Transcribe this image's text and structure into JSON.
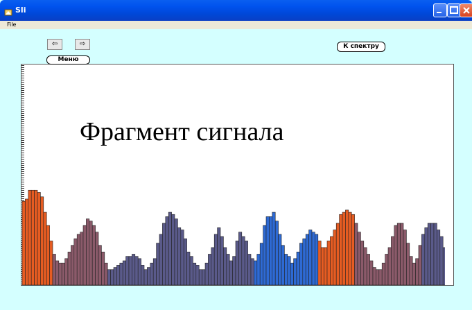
{
  "window": {
    "title": "Sli",
    "app_icon": "app-icon",
    "controls": [
      "minimize-icon",
      "maximize-icon",
      "close-icon"
    ]
  },
  "menu": {
    "file": "File"
  },
  "nav": {
    "prev_icon": "arrow-left-icon",
    "prev_glyph": "⇦",
    "next_icon": "arrow-right-icon",
    "next_glyph": "⇨"
  },
  "buttons": {
    "spectrum": "К спектру",
    "menu": "Меню"
  },
  "panel": {
    "title": "Фрагмент сигнала"
  },
  "colors": {
    "background": "#d4ffff",
    "bar_orange": "#e65c22",
    "bar_mauve": "#8b5a6a",
    "bar_slate": "#5a5a8a",
    "bar_blue": "#2e6ad4"
  },
  "chart_data": {
    "type": "bar",
    "values": [
      0.38,
      0.39,
      0.43,
      0.43,
      0.43,
      0.42,
      0.4,
      0.33,
      0.27,
      0.2,
      0.14,
      0.11,
      0.1,
      0.1,
      0.12,
      0.15,
      0.18,
      0.21,
      0.23,
      0.24,
      0.27,
      0.3,
      0.29,
      0.27,
      0.24,
      0.18,
      0.15,
      0.1,
      0.07,
      0.07,
      0.08,
      0.09,
      0.1,
      0.11,
      0.13,
      0.13,
      0.14,
      0.13,
      0.12,
      0.09,
      0.07,
      0.08,
      0.1,
      0.12,
      0.19,
      0.23,
      0.28,
      0.31,
      0.33,
      0.32,
      0.3,
      0.26,
      0.25,
      0.21,
      0.15,
      0.13,
      0.1,
      0.09,
      0.07,
      0.07,
      0.1,
      0.14,
      0.17,
      0.23,
      0.26,
      0.22,
      0.17,
      0.14,
      0.11,
      0.13,
      0.2,
      0.24,
      0.22,
      0.2,
      0.14,
      0.12,
      0.11,
      0.14,
      0.19,
      0.27,
      0.31,
      0.31,
      0.33,
      0.29,
      0.23,
      0.18,
      0.14,
      0.13,
      0.1,
      0.12,
      0.15,
      0.19,
      0.21,
      0.23,
      0.25,
      0.24,
      0.23,
      0.2,
      0.17,
      0.17,
      0.2,
      0.22,
      0.25,
      0.28,
      0.32,
      0.33,
      0.34,
      0.33,
      0.32,
      0.28,
      0.24,
      0.2,
      0.17,
      0.14,
      0.11,
      0.08,
      0.07,
      0.07,
      0.1,
      0.14,
      0.17,
      0.22,
      0.27,
      0.28,
      0.28,
      0.25,
      0.19,
      0.13,
      0.1,
      0.12,
      0.18,
      0.23,
      0.26,
      0.28,
      0.28,
      0.28,
      0.25,
      0.22,
      0.17,
      0.09,
      0.03
    ],
    "segments": [
      {
        "color_key": "bar_orange",
        "count": 10
      },
      {
        "color_key": "bar_mauve",
        "count": 18
      },
      {
        "color_key": "bar_slate",
        "count": 48
      },
      {
        "color_key": "bar_blue",
        "count": 21
      },
      {
        "color_key": "bar_orange",
        "count": 12
      },
      {
        "color_key": "bar_mauve",
        "count": 22
      },
      {
        "color_key": "bar_slate",
        "count": 22
      }
    ],
    "ylim": [
      0,
      1
    ]
  }
}
